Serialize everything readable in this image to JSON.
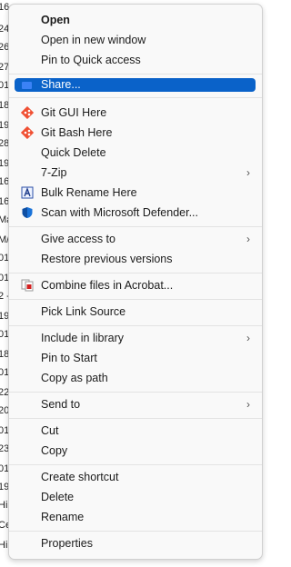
{
  "menu": {
    "items": [
      {
        "label": "Open",
        "bold": true
      },
      {
        "label": "Open in new window"
      },
      {
        "label": "Pin to Quick access"
      },
      {
        "label": "Share...",
        "highlighted": true,
        "icon": "share-icon"
      },
      {
        "label": "Git GUI Here",
        "icon": "git-gui-icon"
      },
      {
        "label": "Git Bash Here",
        "icon": "git-bash-icon"
      },
      {
        "label": "Quick Delete"
      },
      {
        "label": "7-Zip",
        "submenu": true
      },
      {
        "label": "Bulk Rename Here",
        "icon": "bulk-rename-icon"
      },
      {
        "label": "Scan with Microsoft Defender...",
        "icon": "defender-shield-icon"
      },
      {
        "label": "Give access to",
        "submenu": true
      },
      {
        "label": "Restore previous versions"
      },
      {
        "label": "Combine files in Acrobat...",
        "icon": "acrobat-combine-icon"
      },
      {
        "label": "Pick Link Source"
      },
      {
        "label": "Include in library",
        "submenu": true
      },
      {
        "label": "Pin to Start"
      },
      {
        "label": "Copy as path"
      },
      {
        "label": "Send to",
        "submenu": true
      },
      {
        "label": "Cut"
      },
      {
        "label": "Copy"
      },
      {
        "label": "Create shortcut"
      },
      {
        "label": "Delete"
      },
      {
        "label": "Rename"
      },
      {
        "label": "Properties"
      }
    ],
    "submenu_arrow": "›",
    "colors": {
      "highlight": "#0a62c9",
      "menu_bg": "#f9f9f9",
      "text": "#1b1b1b"
    }
  },
  "background_fragments": [
    "16",
    "24",
    "26",
    "27",
    "01",
    "18",
    "19",
    "28",
    "19",
    "16",
    "16",
    "Ma",
    "M/",
    "01",
    "01",
    "2 -",
    "19",
    "01",
    "18",
    "01",
    "22",
    "20",
    "01",
    "23",
    "01",
    "19",
    "Hi",
    "Ce",
    "Hi"
  ]
}
